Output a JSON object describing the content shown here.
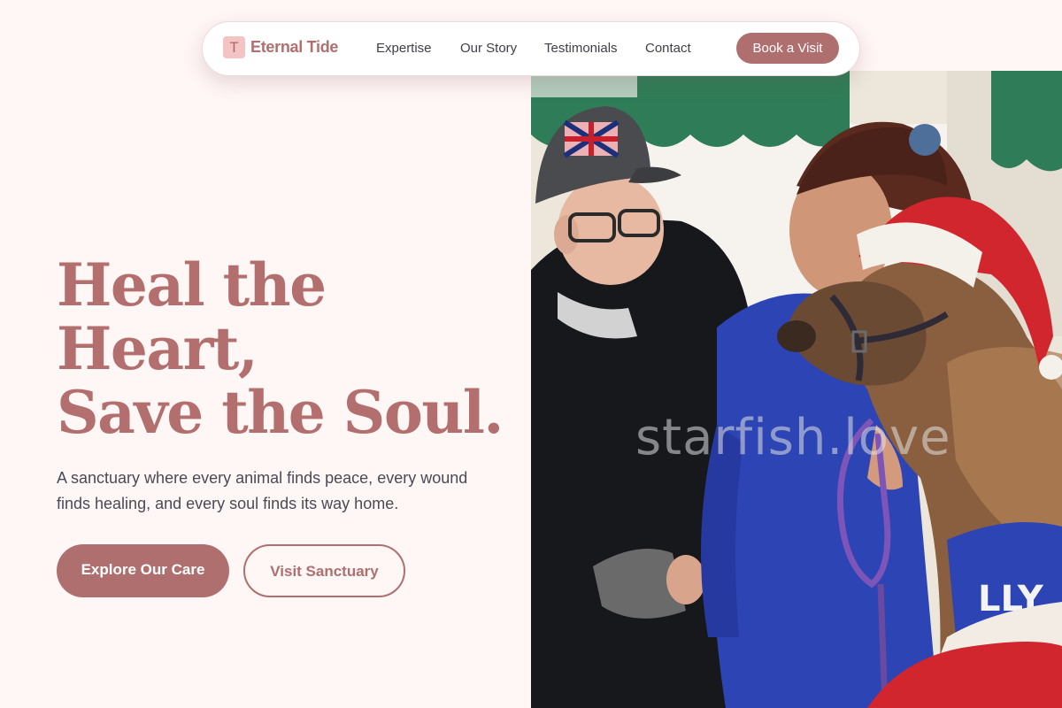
{
  "brand": {
    "mark": "T",
    "name": "Eternal Tide"
  },
  "nav": {
    "links": [
      "Expertise",
      "Our Story",
      "Testimonials",
      "Contact"
    ],
    "cta": "Book a Visit"
  },
  "hero": {
    "title_lines": [
      "Heal the",
      "Heart,",
      "Save the Soul."
    ],
    "subtitle": "A sanctuary where every animal finds peace, every wound finds healing, and every soul finds its way home.",
    "primary_button": "Explore Our Care",
    "secondary_button": "Visit Sanctuary",
    "image_watermark": "starfish.love"
  },
  "colors": {
    "accent": "#b06f6f",
    "background": "#fff6f6",
    "brand_mark_bg": "#f4c4c4",
    "text_dark": "#3f3f4a"
  }
}
